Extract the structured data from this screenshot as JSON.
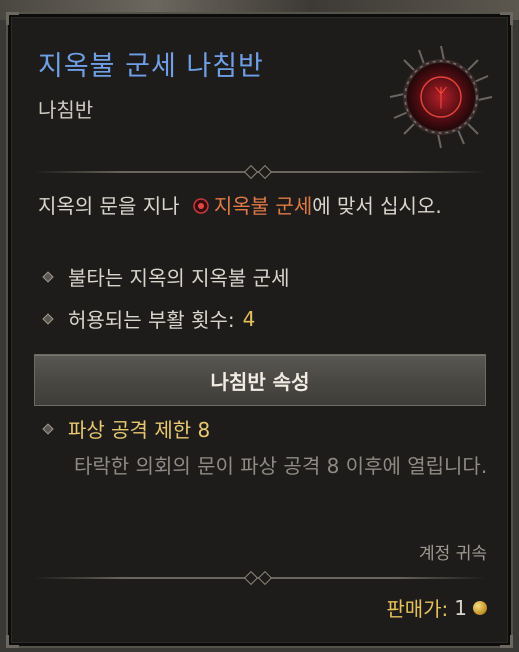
{
  "item": {
    "name": "지옥불 군세 나침반",
    "type": "나침반",
    "icon": "hellborne-compass-icon"
  },
  "description": {
    "before": "지옥의 문을 지나 ",
    "highlight": "지옥불 군세",
    "after": "에 맞서 십시오.",
    "highlight_color": "#e07a45"
  },
  "properties": [
    {
      "text": "불타는 지옥의 지옥불 군세",
      "value": ""
    },
    {
      "text": "허용되는 부활 횟수:",
      "value": "4"
    }
  ],
  "affix_section": {
    "header": "나침반 속성",
    "affix_title": "파상 공격 제한 8",
    "affix_desc": "타락한 의회의 문이 파상 공격 8 이후에 열립니다."
  },
  "binding": "계정 귀속",
  "sell": {
    "label": "판매가:",
    "value": "1",
    "icon": "gold-coin-icon"
  },
  "colors": {
    "title": "#6f9fe6",
    "value": "#e7c05a",
    "affix": "#e8c870"
  }
}
